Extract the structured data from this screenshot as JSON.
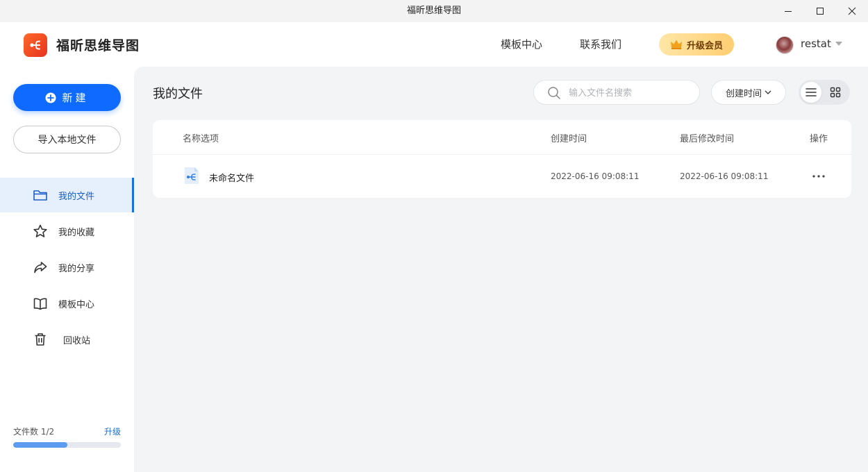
{
  "window": {
    "title": "福昕思维导图"
  },
  "header": {
    "app_name": "福昕思维导图",
    "nav": [
      "模板中心",
      "联系我们"
    ],
    "upgrade_label": "升级会员",
    "username": "restat"
  },
  "sidebar": {
    "new_label": "新建",
    "import_label": "导入本地文件",
    "items": [
      {
        "label": "我的文件",
        "icon": "folder-icon",
        "active": true
      },
      {
        "label": "我的收藏",
        "icon": "star-icon"
      },
      {
        "label": "我的分享",
        "icon": "share-icon"
      },
      {
        "label": "模板中心",
        "icon": "book-icon"
      },
      {
        "label": "回收站",
        "icon": "trash-icon"
      }
    ],
    "quota_label": "文件数 1/2",
    "quota_upgrade": "升级",
    "quota_fraction": 0.5
  },
  "main": {
    "title": "我的文件",
    "search_placeholder": "输入文件名搜索",
    "sort_label": "创建时间",
    "view_mode": "list",
    "table": {
      "columns": [
        "名称选项",
        "创建时间",
        "最后修改时间",
        "操作"
      ],
      "rows": [
        {
          "name": "未命名文件",
          "created": "2022-06-16 09:08:11",
          "modified": "2022-06-16 09:08:11"
        }
      ]
    }
  },
  "colors": {
    "primary": "#0f6bff",
    "accent_orange": "#ff5a1f",
    "vip_gold": "#ffce72"
  }
}
